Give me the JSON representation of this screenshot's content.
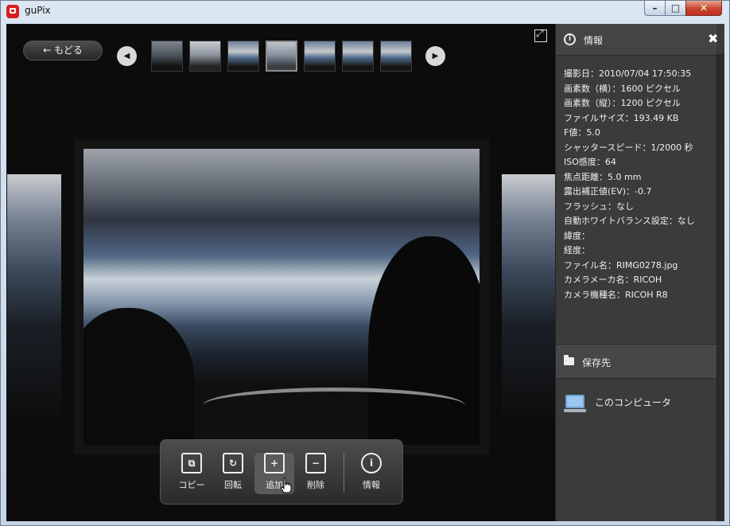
{
  "window": {
    "title": "guPix",
    "controls": {
      "minimize": "–",
      "maximize": "□",
      "close": "✕"
    }
  },
  "viewer": {
    "back_label": "もどる",
    "prev_icon": "◀",
    "next_icon": "▶",
    "fullscreen_icon": "⤢",
    "thumbnail_count": 7,
    "selected_thumbnail": 4
  },
  "toolbar": {
    "items": [
      {
        "label": "コピー",
        "icon": "copy-icon",
        "glyph": "⧉"
      },
      {
        "label": "回転",
        "icon": "rotate-icon",
        "glyph": "↻"
      },
      {
        "label": "追加",
        "icon": "add-to-list-icon",
        "glyph": "+"
      },
      {
        "label": "削除",
        "icon": "remove-from-list-icon",
        "glyph": "−"
      },
      {
        "label": "情報",
        "icon": "info-icon",
        "glyph": "i"
      }
    ]
  },
  "info_panel": {
    "title": "情報",
    "close_glyph": "✖",
    "rows": [
      "撮影日：2010/07/04 17:50:35",
      "画素数（横）：1600 ピクセル",
      "画素数（縦）：1200 ピクセル",
      "ファイルサイズ：193.49 KB",
      "F値：5.0",
      "シャッタースピード：1/2000 秒",
      "ISO感度：64",
      "焦点距離：5.0 mm",
      "露出補正値(EV)：-0.7",
      "フラッシュ：なし",
      "自動ホワイトバランス設定：なし",
      "緯度：",
      "経度：",
      "ファイル名：RIMG0278.jpg",
      "カメラメーカ名：RICOH",
      "カメラ機種名：RICOH R8"
    ],
    "save_section": "保存先",
    "save_target": "このコンピュータ"
  }
}
